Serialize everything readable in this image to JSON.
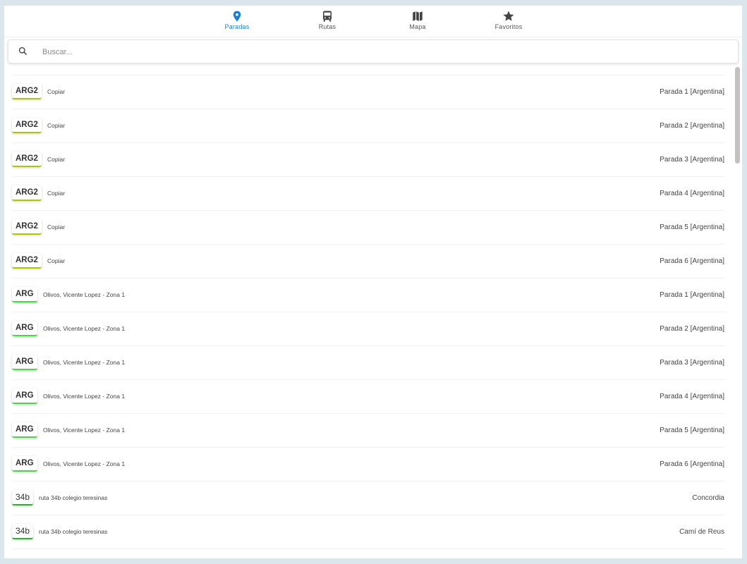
{
  "tabs": [
    {
      "label": "Paradas",
      "icon": "map-pin-icon",
      "active": true
    },
    {
      "label": "Rutas",
      "icon": "bus-icon",
      "active": false
    },
    {
      "label": "Mapa",
      "icon": "map-icon",
      "active": false
    },
    {
      "label": "Favoritos",
      "icon": "star-icon",
      "active": false
    }
  ],
  "search": {
    "placeholder": "Buscar...",
    "value": ""
  },
  "colors": {
    "accent": "#1a7fd4",
    "arg2": "#b5c400",
    "arg": "#3ee03e",
    "r34b": "#22bb22",
    "background": "#dbe6ec"
  },
  "stops": [
    {
      "code": "ARG2",
      "desc": "Copiar",
      "name": "Parada 1 [Argentina]",
      "color": "#b5c400"
    },
    {
      "code": "ARG2",
      "desc": "Copiar",
      "name": "Parada 2 [Argentina]",
      "color": "#b5c400"
    },
    {
      "code": "ARG2",
      "desc": "Copiar",
      "name": "Parada 3 [Argentina]",
      "color": "#b5c400"
    },
    {
      "code": "ARG2",
      "desc": "Copiar",
      "name": "Parada 4 [Argentina]",
      "color": "#b5c400"
    },
    {
      "code": "ARG2",
      "desc": "Copiar",
      "name": "Parada 5 [Argentina]",
      "color": "#b5c400"
    },
    {
      "code": "ARG2",
      "desc": "Copiar",
      "name": "Parada 6 [Argentina]",
      "color": "#b5c400"
    },
    {
      "code": "ARG",
      "desc": "Olivos, Vicente Lopez - Zona 1",
      "name": "Parada 1 [Argentina]",
      "color": "#3ee03e"
    },
    {
      "code": "ARG",
      "desc": "Olivos, Vicente Lopez - Zona 1",
      "name": "Parada 2 [Argentina]",
      "color": "#3ee03e"
    },
    {
      "code": "ARG",
      "desc": "Olivos, Vicente Lopez - Zona 1",
      "name": "Parada 3 [Argentina]",
      "color": "#3ee03e"
    },
    {
      "code": "ARG",
      "desc": "Olivos, Vicente Lopez - Zona 1",
      "name": "Parada 4 [Argentina]",
      "color": "#3ee03e"
    },
    {
      "code": "ARG",
      "desc": "Olivos, Vicente Lopez - Zona 1",
      "name": "Parada 5 [Argentina]",
      "color": "#3ee03e"
    },
    {
      "code": "ARG",
      "desc": "Olivos, Vicente Lopez - Zona 1",
      "name": "Parada 6 [Argentina]",
      "color": "#3ee03e"
    },
    {
      "code": "34b",
      "desc": "ruta 34b colegio teresinas",
      "name": "Concordia",
      "color": "#22bb22"
    },
    {
      "code": "34b",
      "desc": "ruta 34b colegio teresinas",
      "name": "Camí de Reus",
      "color": "#22bb22"
    }
  ]
}
